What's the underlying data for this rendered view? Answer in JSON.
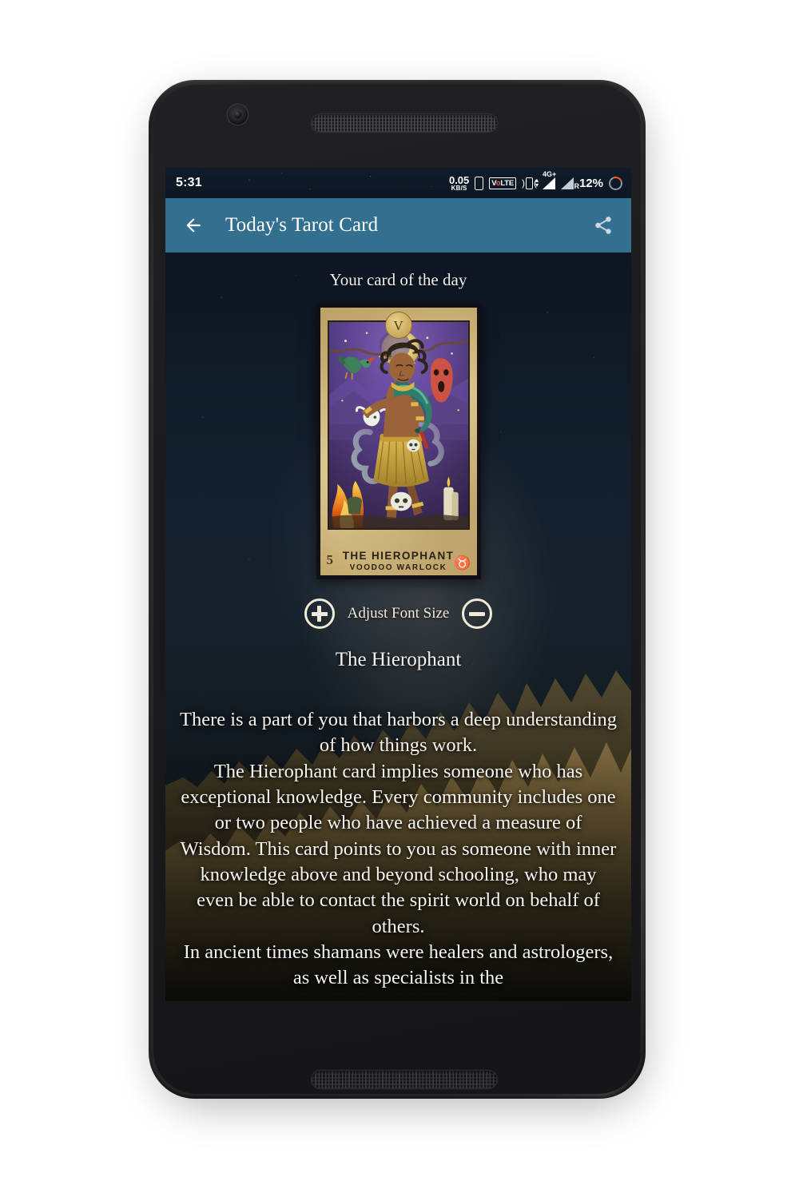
{
  "status_bar": {
    "clock": "5:31",
    "net_speed_value": "0.05",
    "net_speed_unit": "KB/S",
    "sim_icon": "sim-card-icon",
    "volte_prefix": "V",
    "volte_o": "o",
    "volte_suffix": "LTE",
    "vibrate_icon": "vibrate-icon",
    "signal1_label": "4G",
    "signal1_plus": "+",
    "signal2_label": "R",
    "battery_percent": "12%",
    "battery_icon": "battery-ring-icon"
  },
  "app_bar": {
    "back_icon": "back-arrow-icon",
    "title": "Today's Tarot Card",
    "share_icon": "share-icon",
    "background_color": "#33708f"
  },
  "content": {
    "section_heading": "Your card of the day",
    "tarot_card": {
      "roman_numeral": "V",
      "name": "THE HIEROPHANT",
      "subtitle": "VOODOO WARLOCK",
      "number": "5",
      "zodiac_symbol": "♉",
      "zodiac_color": "#b4362e"
    },
    "font_size_control": {
      "increase_icon": "plus-circle-icon",
      "label": "Adjust Font Size",
      "decrease_icon": "minus-circle-icon"
    },
    "card_title": "The Hierophant",
    "card_description": "There is a part of you that harbors a deep understanding of how things work.\nThe Hierophant card implies someone who has exceptional knowledge. Every community includes one or two people who have achieved a measure of Wisdom. This card points to you as someone with inner knowledge above and beyond schooling, who may even be able to contact the spirit world on behalf of others.\nIn ancient times shamans were healers and astrologers, as well as specialists in the"
  },
  "device": {
    "front_camera_icon": "front-camera-icon",
    "earpiece_icon": "earpiece-speaker-icon",
    "bottom_speaker_icon": "bottom-speaker-icon"
  }
}
